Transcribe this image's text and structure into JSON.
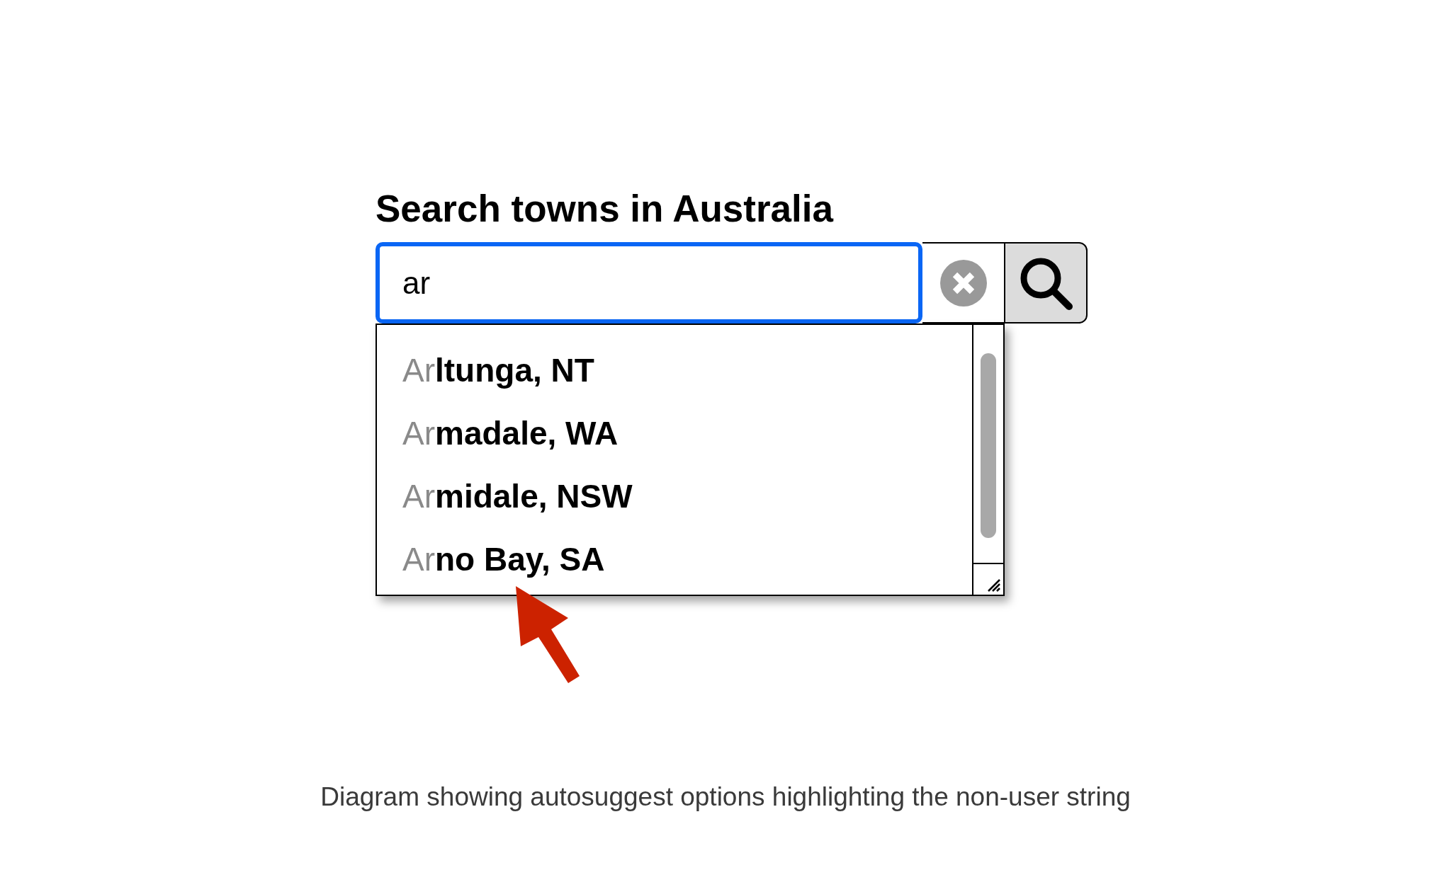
{
  "heading": "Search towns in Australia",
  "search_field": {
    "value": "ar",
    "focused": true
  },
  "suggestions": [
    {
      "label": "Ar**ltunga, NT**"
    },
    {
      "label": "Ar**madale, WA**"
    },
    {
      "label": "Ar**midale, NSW**"
    },
    {
      "label": "Ar**no Bay, SA**"
    }
  ],
  "caption": "Diagram showing autosuggest options highlighting the non-user string"
}
